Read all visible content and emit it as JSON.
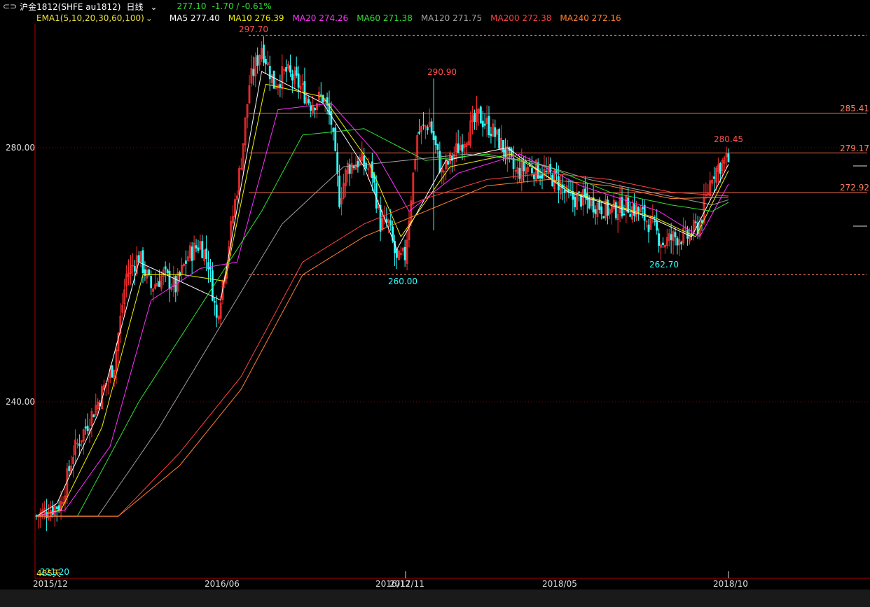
{
  "header": {
    "symbol_icon": "link-icon",
    "symbol": "沪金1812(SHFE au1812)",
    "period": "日线",
    "period_icon": "chevron-down-icon",
    "last": "277.10",
    "change": "-1.70 / -0.61%"
  },
  "indicators": [
    {
      "label": "EMA1(5,10,20,30,60,100)",
      "color": "#e8e040"
    },
    {
      "label": "MA5 277.40",
      "color": "#ffffff"
    },
    {
      "label": "MA10 276.39",
      "color": "#f0f000"
    },
    {
      "label": "MA20 274.26",
      "color": "#ff30ff"
    },
    {
      "label": "MA60 271.38",
      "color": "#30e030"
    },
    {
      "label": "MA120 271.75",
      "color": "#a0a0a0"
    },
    {
      "label": "MA200 272.38",
      "color": "#ff4040"
    },
    {
      "label": "MA240 272.16",
      "color": "#ff8030"
    }
  ],
  "indicator_dropdown_icon": "chevron-down-icon",
  "y_axis": {
    "ticks": [
      "280.00",
      "240.00"
    ]
  },
  "annotations": {
    "high": "297.70",
    "peak2": "290.90",
    "low1": "260.00",
    "low2": "262.70",
    "recent_high": "280.45",
    "level1": "285.41",
    "level2": "279.17",
    "level3": "272.92",
    "start_low": "221.20",
    "overlay_label": "485天"
  },
  "x_axis": {
    "labels": [
      "2015/12",
      "2016/06",
      "2016/12",
      "2017/11",
      "2018/05",
      "2018/10"
    ]
  },
  "chart_data": {
    "type": "line",
    "title": "",
    "y_range": [
      216,
      304
    ],
    "price_path": [
      [
        0,
        222
      ],
      [
        6,
        223
      ],
      [
        12,
        224
      ],
      [
        18,
        232
      ],
      [
        24,
        236
      ],
      [
        30,
        240
      ],
      [
        38,
        246
      ],
      [
        44,
        260
      ],
      [
        50,
        263
      ],
      [
        56,
        258
      ],
      [
        62,
        260
      ],
      [
        68,
        258
      ],
      [
        74,
        263
      ],
      [
        80,
        265
      ],
      [
        84,
        262
      ],
      [
        88,
        253
      ],
      [
        94,
        265
      ],
      [
        100,
        278
      ],
      [
        104,
        290
      ],
      [
        110,
        296
      ],
      [
        116,
        290
      ],
      [
        122,
        292
      ],
      [
        128,
        290
      ],
      [
        134,
        287
      ],
      [
        140,
        288
      ],
      [
        144,
        284
      ],
      [
        148,
        272
      ],
      [
        152,
        277
      ],
      [
        158,
        278
      ],
      [
        164,
        276
      ],
      [
        168,
        268
      ],
      [
        172,
        268
      ],
      [
        176,
        262
      ],
      [
        180,
        263
      ],
      [
        186,
        282
      ],
      [
        192,
        284
      ],
      [
        198,
        276
      ],
      [
        204,
        279
      ],
      [
        210,
        282
      ],
      [
        216,
        285
      ],
      [
        222,
        283
      ],
      [
        228,
        280
      ],
      [
        234,
        276
      ],
      [
        240,
        277
      ],
      [
        248,
        276
      ],
      [
        254,
        275
      ],
      [
        260,
        272
      ],
      [
        266,
        272
      ],
      [
        274,
        271
      ],
      [
        280,
        270
      ],
      [
        288,
        271
      ],
      [
        294,
        270
      ],
      [
        300,
        268
      ],
      [
        306,
        265
      ],
      [
        312,
        266
      ],
      [
        318,
        266
      ],
      [
        324,
        268
      ],
      [
        330,
        276
      ],
      [
        336,
        278
      ],
      [
        338,
        278
      ]
    ],
    "moving_averages": [
      {
        "name": "MA5",
        "color": "#ffffff",
        "path": [
          [
            0,
            222
          ],
          [
            10,
            224
          ],
          [
            30,
            238
          ],
          [
            50,
            262
          ],
          [
            70,
            259
          ],
          [
            90,
            256
          ],
          [
            110,
            292
          ],
          [
            140,
            287
          ],
          [
            160,
            277
          ],
          [
            176,
            264
          ],
          [
            200,
            278
          ],
          [
            230,
            280
          ],
          [
            260,
            273
          ],
          [
            300,
            269
          ],
          [
            320,
            266
          ],
          [
            338,
            277.4
          ]
        ]
      },
      {
        "name": "MA10",
        "color": "#f0f000",
        "path": [
          [
            0,
            222
          ],
          [
            12,
            223
          ],
          [
            32,
            236
          ],
          [
            52,
            260
          ],
          [
            72,
            260
          ],
          [
            92,
            259
          ],
          [
            112,
            290
          ],
          [
            140,
            288
          ],
          [
            162,
            278
          ],
          [
            178,
            266
          ],
          [
            202,
            277
          ],
          [
            232,
            279
          ],
          [
            262,
            273
          ],
          [
            302,
            269
          ],
          [
            322,
            266
          ],
          [
            338,
            276.4
          ]
        ]
      },
      {
        "name": "MA20",
        "color": "#ff30ff",
        "path": [
          [
            0,
            222
          ],
          [
            14,
            223
          ],
          [
            36,
            233
          ],
          [
            56,
            256
          ],
          [
            80,
            261
          ],
          [
            98,
            262
          ],
          [
            118,
            286
          ],
          [
            144,
            287
          ],
          [
            166,
            279
          ],
          [
            182,
            270
          ],
          [
            206,
            276
          ],
          [
            236,
            279
          ],
          [
            266,
            274
          ],
          [
            304,
            270
          ],
          [
            324,
            266
          ],
          [
            338,
            274.3
          ]
        ]
      },
      {
        "name": "MA60",
        "color": "#30e030",
        "path": [
          [
            0,
            222
          ],
          [
            20,
            222
          ],
          [
            50,
            240
          ],
          [
            80,
            255
          ],
          [
            110,
            270
          ],
          [
            130,
            282
          ],
          [
            160,
            283
          ],
          [
            190,
            278
          ],
          [
            220,
            279
          ],
          [
            250,
            277
          ],
          [
            280,
            273
          ],
          [
            310,
            271
          ],
          [
            330,
            270
          ],
          [
            338,
            271.4
          ]
        ]
      },
      {
        "name": "MA120",
        "color": "#a0a0a0",
        "path": [
          [
            0,
            222
          ],
          [
            30,
            222
          ],
          [
            60,
            236
          ],
          [
            90,
            252
          ],
          [
            120,
            268
          ],
          [
            150,
            277
          ],
          [
            180,
            278
          ],
          [
            210,
            279
          ],
          [
            240,
            278
          ],
          [
            270,
            275
          ],
          [
            300,
            273
          ],
          [
            330,
            271
          ],
          [
            338,
            271.8
          ]
        ]
      },
      {
        "name": "MA200",
        "color": "#ff4040",
        "path": [
          [
            0,
            222
          ],
          [
            40,
            222
          ],
          [
            70,
            232
          ],
          [
            100,
            244
          ],
          [
            130,
            262
          ],
          [
            160,
            268
          ],
          [
            190,
            272
          ],
          [
            220,
            275
          ],
          [
            250,
            276
          ],
          [
            280,
            275
          ],
          [
            310,
            273
          ],
          [
            338,
            272.4
          ]
        ]
      },
      {
        "name": "MA240",
        "color": "#ff8030",
        "path": [
          [
            0,
            222
          ],
          [
            40,
            222
          ],
          [
            70,
            230
          ],
          [
            100,
            242
          ],
          [
            130,
            260
          ],
          [
            160,
            266
          ],
          [
            190,
            270
          ],
          [
            220,
            274
          ],
          [
            250,
            275
          ],
          [
            280,
            274
          ],
          [
            310,
            272
          ],
          [
            338,
            272.2
          ]
        ]
      }
    ],
    "horizontal_levels": [
      297.7,
      285.41,
      279.17,
      272.92,
      260.0
    ],
    "spike": {
      "bar": 194,
      "high": 290.9,
      "low": 267
    }
  }
}
